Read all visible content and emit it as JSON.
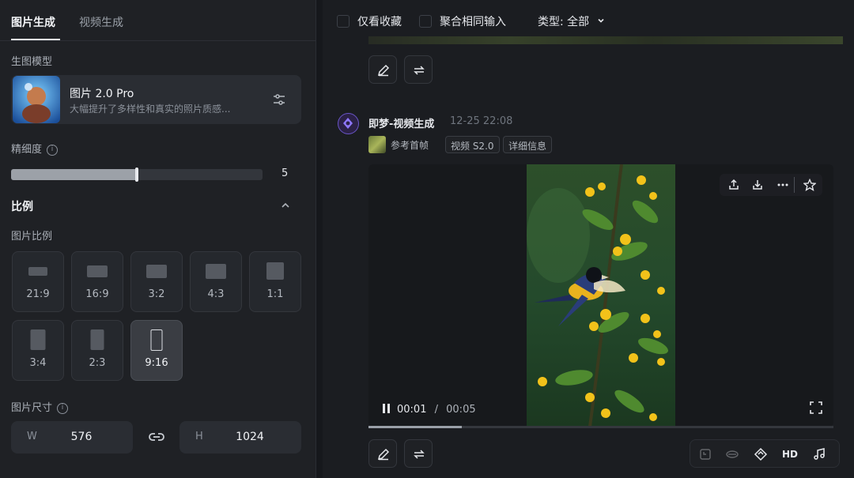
{
  "tabs": {
    "image_gen": "图片生成",
    "video_gen": "视频生成"
  },
  "model": {
    "section_label": "生图模型",
    "name": "图片 2.0 Pro",
    "description": "大幅提升了多样性和真实的照片质感..."
  },
  "detail": {
    "label": "精细度",
    "value": "5",
    "level_fraction": 0.5
  },
  "ratio_section": {
    "title": "比例",
    "subtitle": "图片比例",
    "options": [
      "21:9",
      "16:9",
      "3:2",
      "4:3",
      "1:1",
      "3:4",
      "2:3",
      "9:16"
    ],
    "selected": "9:16"
  },
  "size": {
    "label": "图片尺寸",
    "w_label": "W",
    "w_value": "576",
    "h_label": "H",
    "h_value": "1024"
  },
  "filters": {
    "favorites_only": "仅看收藏",
    "merge_same_input": "聚合相同输入",
    "type_filter": "类型: 全部"
  },
  "generation": {
    "title": "即梦-视频生成",
    "time": "12-25  22:08",
    "ref_tag": "参考首帧",
    "model_tag": "视频 S2.0",
    "details_tag": "详细信息"
  },
  "player": {
    "current_time": "00:01",
    "separator": "/",
    "duration": "00:05",
    "progress_fraction": 0.2
  },
  "actions": {
    "hd_label": "HD"
  },
  "icons": [
    "edit-icon",
    "regenerate-icon",
    "share-icon",
    "download-icon",
    "more-icon",
    "star-icon",
    "fullscreen-icon",
    "play-pause-icon",
    "link-icon",
    "settings-sliders-icon",
    "info-icon",
    "chevron-up-icon",
    "chevron-down-icon",
    "extend-icon",
    "lip-sync-icon",
    "diamond-icon",
    "music-icon"
  ],
  "colors": {
    "panel_bg": "#1f2125",
    "main_bg": "#1b1d21",
    "accent_purple": "#6a55c9"
  }
}
